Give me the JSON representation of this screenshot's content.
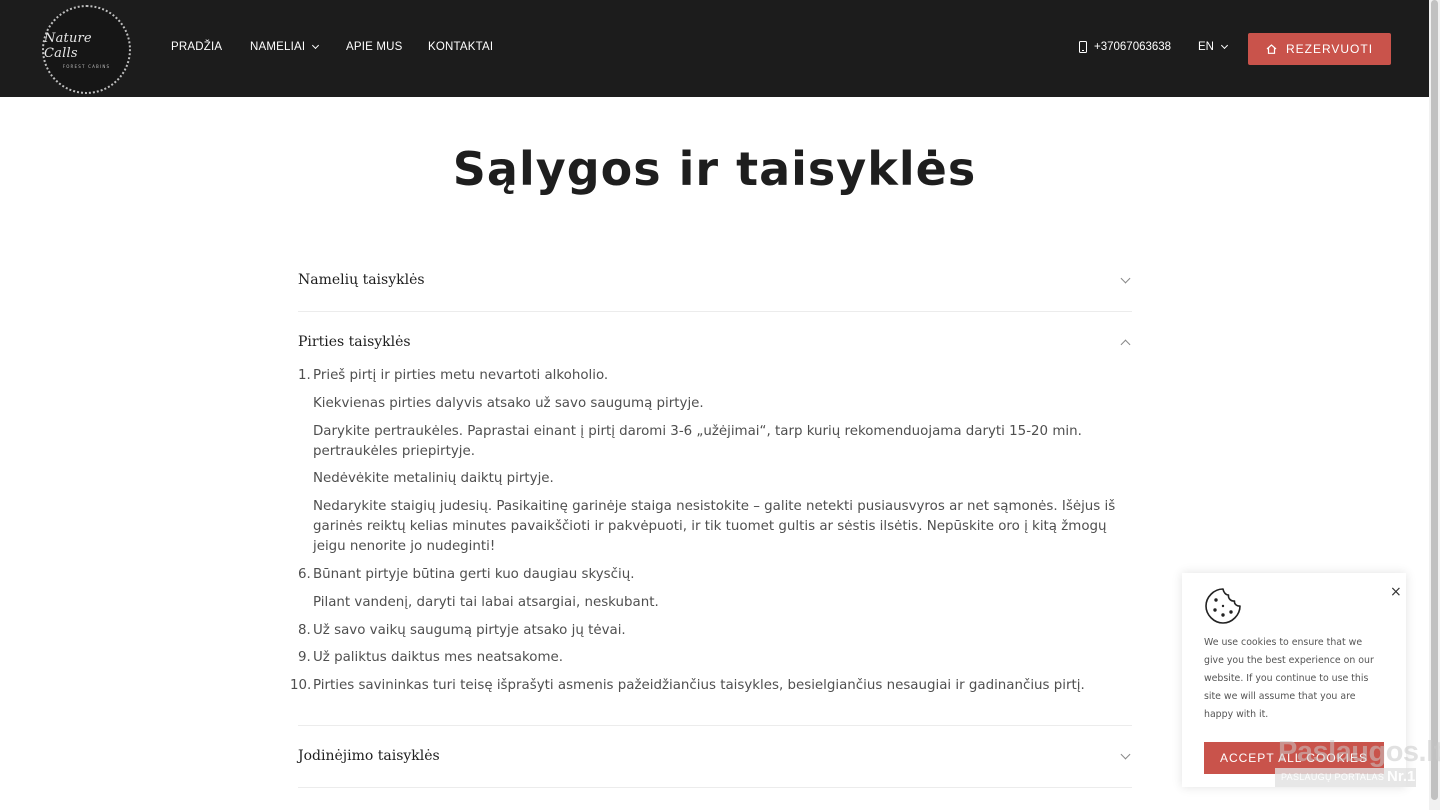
{
  "header": {
    "logo": {
      "title": "Nature Calls",
      "subtitle": "FOREST CABINS"
    },
    "nav": [
      {
        "label": "PRADŽIA"
      },
      {
        "label": "NAMELIAI"
      },
      {
        "label": "APIE MUS"
      },
      {
        "label": "KONTAKTAI"
      }
    ],
    "phone": "+37067063638",
    "language": "EN",
    "reserve_label": "REZERVUOTI"
  },
  "colors": {
    "header_bg": "#1c1c1c",
    "accent": "#c9534b"
  },
  "main": {
    "title": "Sąlygos ir taisyklės",
    "sections": [
      {
        "title": "Namelių taisyklės",
        "expanded": false
      },
      {
        "title": "Pirties taisyklės",
        "expanded": true
      },
      {
        "title": "Jodinėjimo taisyklės",
        "expanded": false
      }
    ],
    "sauna_rules": [
      {
        "num": "1.",
        "text": "Prieš pirtį ir pirties metu nevartoti alkoholio."
      },
      {
        "num": "",
        "text": "Kiekvienas pirties dalyvis atsako už savo saugumą pirtyje."
      },
      {
        "num": "",
        "text": "Darykite pertraukėles. Paprastai einant į pirtį daromi 3-6 „užėjimai“, tarp kurių rekomenduojama daryti 15-20 min. pertraukėles priepirtyje."
      },
      {
        "num": "",
        "text": "Nedėvėkite metalinių daiktų pirtyje."
      },
      {
        "num": "",
        "text": "Nedarykite staigių judesių. Pasikaitinę garinėje staiga nesistokite – galite netekti pusiausvyros ar net sąmonės. Išėjus iš garinės reiktų kelias minutes pavaikščioti ir pakvėpuoti, ir tik tuomet gultis ar sėstis ilsėtis. Nepūskite oro į kitą žmogų jeigu nenorite jo nudeginti!"
      },
      {
        "num": "6.",
        "text": "Būnant pirtyje būtina gerti kuo daugiau skysčių."
      },
      {
        "num": "",
        "text": "Pilant vandenį, daryti tai labai atsargiai, neskubant."
      },
      {
        "num": "8.",
        "text": "Už savo vaikų saugumą pirtyje atsako jų tėvai."
      },
      {
        "num": "9.",
        "text": "Už paliktus daiktus mes neatsakome."
      },
      {
        "num": "10.",
        "text": "Pirties savininkas turi teisę išprašyti asmenis pažeidžiančius taisykles, besielgiančius nesaugiai ir gadinančius pirtį."
      }
    ]
  },
  "cookie": {
    "text": "We use cookies to ensure that we give you the best experience on our website. If you continue to use this site we will assume that you are happy with it.",
    "close": "×",
    "accept_label": "ACCEPT ALL COOKIES"
  },
  "watermark": {
    "main": "Paslaugos.lt",
    "sub": "PASLAUGŲ PORTALAS",
    "badge": "Nr.1"
  }
}
